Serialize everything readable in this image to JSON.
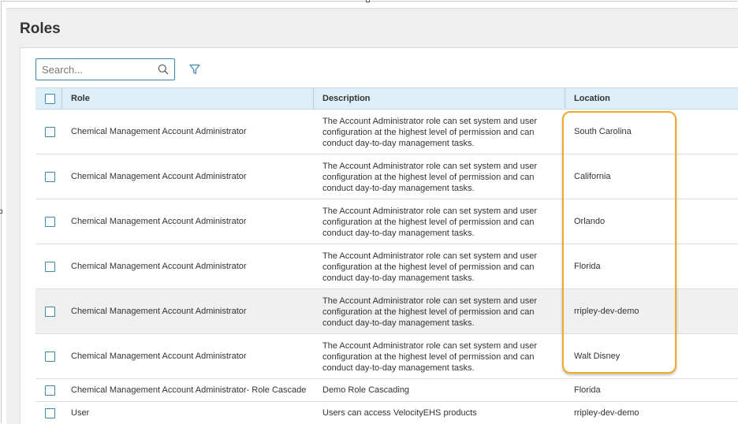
{
  "page": {
    "title": "Roles"
  },
  "search": {
    "placeholder": "Search..."
  },
  "table": {
    "columns": [
      "Role",
      "Description",
      "Location"
    ],
    "rows": [
      {
        "role": "Chemical Management Account Administrator",
        "description": "The Account Administrator role can set system and user configuration at the highest level of permission and can conduct day-to-day management tasks.",
        "location": "South Carolina"
      },
      {
        "role": "Chemical Management Account Administrator",
        "description": "The Account Administrator role can set system and user configuration at the highest level of permission and can conduct day-to-day management tasks.",
        "location": "California"
      },
      {
        "role": "Chemical Management Account Administrator",
        "description": "The Account Administrator role can set system and user configuration at the highest level of permission and can conduct day-to-day management tasks.",
        "location": "Orlando"
      },
      {
        "role": "Chemical Management Account Administrator",
        "description": "The Account Administrator role can set system and user configuration at the highest level of permission and can conduct day-to-day management tasks.",
        "location": "Florida"
      },
      {
        "role": "Chemical Management Account Administrator",
        "description": "The Account Administrator role can set system and user configuration at the highest level of permission and can conduct day-to-day management tasks.",
        "location": "rripley-dev-demo"
      },
      {
        "role": "Chemical Management Account Administrator",
        "description": "The Account Administrator role can set system and user configuration at the highest level of permission and can conduct day-to-day management tasks.",
        "location": "Walt Disney"
      },
      {
        "role": "Chemical Management Account Administrator- Role Cascade",
        "description": "Demo Role Cascading",
        "location": "Florida"
      },
      {
        "role": "User",
        "description": "Users can access VelocityEHS products",
        "location": "rripley-dev-demo"
      }
    ]
  },
  "colors": {
    "accent": "#3a8ab0",
    "header_bg": "#ddeef6",
    "highlight": "#f0a928"
  }
}
